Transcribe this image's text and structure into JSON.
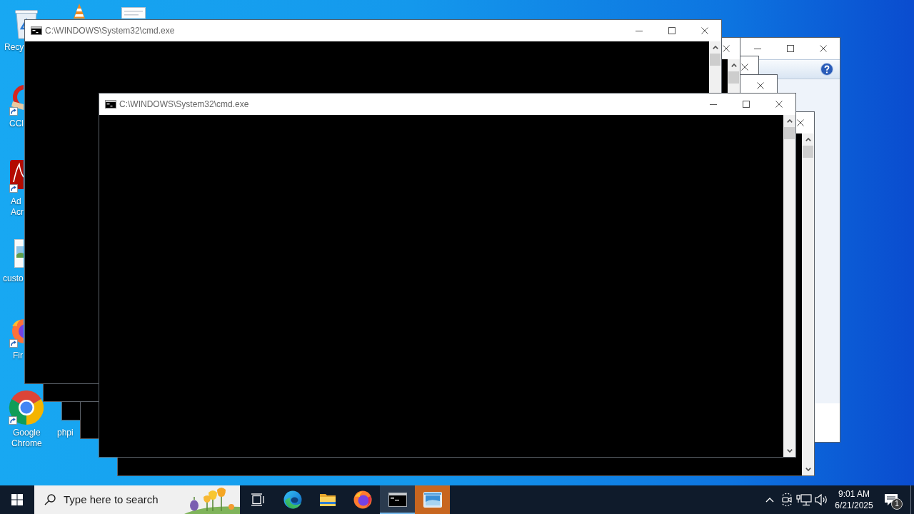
{
  "desktop": {
    "icons": [
      {
        "kind": "trash",
        "label_lines": [
          "Recy"
        ],
        "shortcut": false
      },
      {
        "kind": "cone"
      },
      {
        "kind": "document"
      },
      {
        "kind": "cleaner",
        "label_lines": [
          "CCl"
        ],
        "shortcut": true
      },
      {
        "kind": "pdf",
        "label_lines": [
          "Ad",
          "Acr"
        ],
        "shortcut": true
      },
      {
        "kind": "image",
        "label_lines": [
          "custo"
        ],
        "shortcut": false
      },
      {
        "kind": "firefox",
        "label_lines": [
          "Fir"
        ],
        "shortcut": true
      },
      {
        "kind": "chrome",
        "label_lines": [
          "Google",
          "Chrome"
        ],
        "shortcut": true
      },
      {
        "kind": "label",
        "label_lines": [
          "phpi"
        ]
      }
    ]
  },
  "windows": [
    {
      "kind": "console",
      "title": "C:\\WINDOWS\\System32\\cmd.exe"
    },
    {
      "kind": "console"
    },
    {
      "kind": "dialog"
    },
    {
      "kind": "console"
    },
    {
      "kind": "console"
    },
    {
      "kind": "console",
      "title": "C:\\WINDOWS\\System32\\cmd.exe"
    },
    {
      "kind": "console"
    }
  ],
  "taskbar": {
    "search": {
      "placeholder": "Type here to search"
    },
    "apps": [
      {
        "kind": "taskview",
        "selected": false,
        "flashing": false
      },
      {
        "kind": "browser",
        "selected": false,
        "flashing": false
      },
      {
        "kind": "folder",
        "selected": false,
        "flashing": false
      },
      {
        "kind": "firefox",
        "selected": false,
        "flashing": false
      },
      {
        "kind": "console",
        "selected": true,
        "flashing": false
      },
      {
        "kind": "window",
        "selected": false,
        "flashing": true
      }
    ],
    "clock": {
      "time": "9:01 AM",
      "date": "6/21/2025"
    },
    "notifications": {
      "count": "1"
    }
  }
}
